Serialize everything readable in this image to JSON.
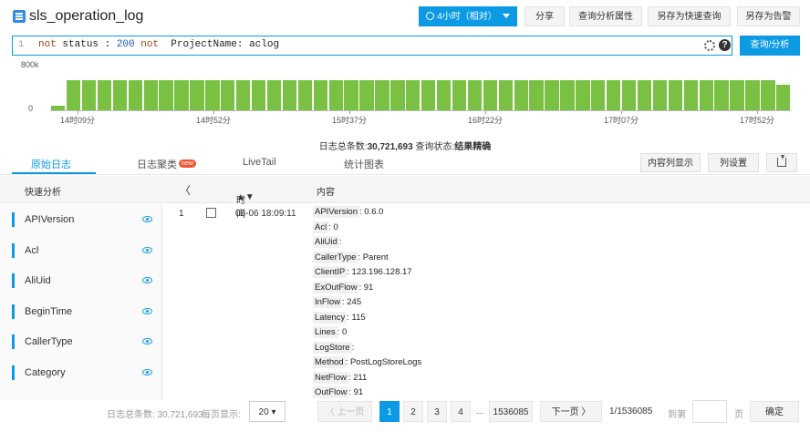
{
  "header": {
    "title": "sls_operation_log",
    "time_range_label": "4小时（相对）",
    "share_label": "分享",
    "query_props_label": "查询分析属性",
    "save_quick_query_label": "另存为快速查询",
    "save_alert_label": "另存为告警"
  },
  "query": {
    "line_number": "1",
    "tokens": [
      {
        "text": "not",
        "type": "keyword"
      },
      {
        "text": " status : ",
        "type": "plain"
      },
      {
        "text": "200",
        "type": "number"
      },
      {
        "text": " ",
        "type": "plain"
      },
      {
        "text": "not",
        "type": "keyword"
      },
      {
        "text": "  ProjectName: aclog",
        "type": "plain"
      }
    ],
    "search_button_label": "查询/分析"
  },
  "histogram": {
    "y_ticks": [
      "800k",
      "0"
    ],
    "x_ticks": [
      "14时09分",
      "14时52分",
      "15时37分",
      "16时22分",
      "17时07分",
      "17时52分"
    ],
    "bar_color": "#7ac143",
    "bar_count": 48,
    "first_bar_fraction": 0.12,
    "typical_bar_fraction": 0.73,
    "last_bar_fraction": 0.62
  },
  "summary": {
    "count_prefix": "日志总条数:",
    "count_value": "30,721,693",
    "status_prefix": "查询状态:",
    "status_value": "结果精确"
  },
  "tabs": {
    "raw_logs": "原始日志",
    "log_cluster": "日志聚类",
    "new_badge": "new",
    "livetail": "LiveTail",
    "stats_chart": "统计图表",
    "column_display": "内容列显示",
    "column_settings": "列设置"
  },
  "table_header": {
    "quick_analysis": "快速分析",
    "collapse": "〈",
    "time": "时间",
    "sort_indicator": "▲▼",
    "content": "内容"
  },
  "fields": [
    "APIVersion",
    "Acl",
    "AliUid",
    "BeginTime",
    "CallerType",
    "Category"
  ],
  "log_row": {
    "index": "1",
    "time": "05-06 18:09:11",
    "entries": [
      {
        "key": "APIVersion",
        "value": ": 0.6.0"
      },
      {
        "key": "Acl",
        "value": ": 0"
      },
      {
        "key": "AliUid",
        "value": ":"
      },
      {
        "key": "CallerType",
        "value": ": Parent"
      },
      {
        "key": "ClientIP",
        "value": ": 123.196.128.17"
      },
      {
        "key": "ExOutFlow",
        "value": ": 91"
      },
      {
        "key": "InFlow",
        "value": ": 245"
      },
      {
        "key": "Latency",
        "value": ": 115"
      },
      {
        "key": "Lines",
        "value": ": 0"
      },
      {
        "key": "LogStore",
        "value": ":"
      },
      {
        "key": "Method",
        "value": ": PostLogStoreLogs"
      },
      {
        "key": "NetFlow",
        "value": ": 211"
      },
      {
        "key": "OutFlow",
        "value": ": 91"
      }
    ]
  },
  "pager": {
    "total_label": "日志总条数: 30,721,693,",
    "per_page_label": "每页显示:",
    "page_size": "20",
    "prev_label": "〈 上一页",
    "pages": [
      "1",
      "2",
      "3",
      "4"
    ],
    "ellipsis": "...",
    "last_page": "1536085",
    "next_label": "下一页 〉",
    "page_status": "1/1536085",
    "goto_label": "到第",
    "page_unit": "页",
    "confirm_label": "确定"
  }
}
